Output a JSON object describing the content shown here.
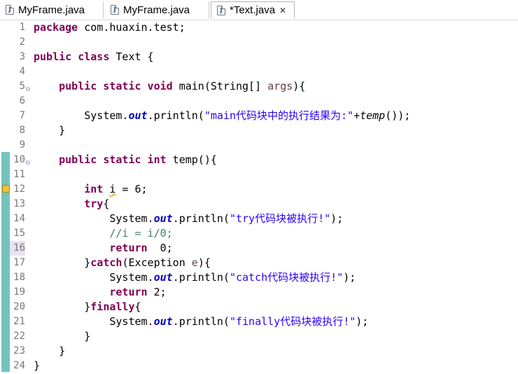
{
  "tabs": [
    {
      "label": "MyFrame.java",
      "active": false
    },
    {
      "label": "MyFrame.java",
      "active": false
    },
    {
      "label": "*Text.java",
      "active": true
    }
  ],
  "icons": {
    "java_file": "java-file-icon",
    "close": "close-icon",
    "warning": "warning-icon",
    "fold": "fold-minus-icon"
  },
  "colors": {
    "keyword": "#7f0055",
    "string": "#2a00ff",
    "field": "#0000c0",
    "comment": "#3f7f5f",
    "change_bar": "#74c3bf"
  },
  "editor": {
    "lines": [
      {
        "n": "1",
        "t": [
          {
            "k": "kw",
            "v": "package"
          },
          {
            "k": "",
            "v": " com.huaxin.test;"
          }
        ]
      },
      {
        "n": "2",
        "t": []
      },
      {
        "n": "3",
        "t": [
          {
            "k": "kw",
            "v": "public class"
          },
          {
            "k": "",
            "v": " Text {"
          }
        ]
      },
      {
        "n": "4",
        "t": []
      },
      {
        "n": "5",
        "fold": true,
        "t": [
          {
            "k": "",
            "v": "    "
          },
          {
            "k": "kw",
            "v": "public static void"
          },
          {
            "k": "",
            "v": " main(String[] "
          },
          {
            "k": "param",
            "v": "args"
          },
          {
            "k": "",
            "v": "){"
          }
        ]
      },
      {
        "n": "6",
        "t": []
      },
      {
        "n": "7",
        "t": [
          {
            "k": "",
            "v": "        System."
          },
          {
            "k": "fld",
            "v": "out"
          },
          {
            "k": "",
            "v": ".println("
          },
          {
            "k": "str",
            "v": "\"main代码块中的执行结果为:\""
          },
          {
            "k": "",
            "v": "+"
          },
          {
            "k": "ital",
            "v": "temp"
          },
          {
            "k": "",
            "v": "());"
          }
        ]
      },
      {
        "n": "8",
        "t": [
          {
            "k": "",
            "v": "    }"
          }
        ]
      },
      {
        "n": "9",
        "t": []
      },
      {
        "n": "10",
        "fold": true,
        "t": [
          {
            "k": "",
            "v": "    "
          },
          {
            "k": "kw",
            "v": "public static int"
          },
          {
            "k": "",
            "v": " temp(){"
          }
        ]
      },
      {
        "n": "11",
        "t": []
      },
      {
        "n": "12",
        "warn": true,
        "t": [
          {
            "k": "",
            "v": "        "
          },
          {
            "k": "kw",
            "v": "int"
          },
          {
            "k": "",
            "v": " "
          },
          {
            "k": "warnu",
            "v": "i"
          },
          {
            "k": "",
            "v": " = 6;"
          }
        ]
      },
      {
        "n": "13",
        "t": [
          {
            "k": "",
            "v": "        "
          },
          {
            "k": "kw",
            "v": "try"
          },
          {
            "k": "",
            "v": "{"
          }
        ]
      },
      {
        "n": "14",
        "t": [
          {
            "k": "",
            "v": "            System."
          },
          {
            "k": "fld",
            "v": "out"
          },
          {
            "k": "",
            "v": ".println("
          },
          {
            "k": "str",
            "v": "\"try代码块被执行!\""
          },
          {
            "k": "",
            "v": ");"
          }
        ]
      },
      {
        "n": "15",
        "t": [
          {
            "k": "",
            "v": "            "
          },
          {
            "k": "cmt",
            "v": "//i = i/0;"
          }
        ]
      },
      {
        "n": "16",
        "cur": true,
        "t": [
          {
            "k": "",
            "v": "            "
          },
          {
            "k": "kw",
            "v": "return"
          },
          {
            "k": "",
            "v": "  0;"
          }
        ]
      },
      {
        "n": "17",
        "t": [
          {
            "k": "",
            "v": "        }"
          },
          {
            "k": "kw",
            "v": "catch"
          },
          {
            "k": "",
            "v": "(Exception "
          },
          {
            "k": "param",
            "v": "e"
          },
          {
            "k": "",
            "v": "){"
          }
        ]
      },
      {
        "n": "18",
        "t": [
          {
            "k": "",
            "v": "            System."
          },
          {
            "k": "fld",
            "v": "out"
          },
          {
            "k": "",
            "v": ".println("
          },
          {
            "k": "str",
            "v": "\"catch代码块被执行!\""
          },
          {
            "k": "",
            "v": ");"
          }
        ]
      },
      {
        "n": "19",
        "t": [
          {
            "k": "",
            "v": "            "
          },
          {
            "k": "kw",
            "v": "return"
          },
          {
            "k": "",
            "v": " 2;"
          }
        ]
      },
      {
        "n": "20",
        "t": [
          {
            "k": "",
            "v": "        }"
          },
          {
            "k": "kw",
            "v": "finally"
          },
          {
            "k": "",
            "v": "{"
          }
        ]
      },
      {
        "n": "21",
        "t": [
          {
            "k": "",
            "v": "            System."
          },
          {
            "k": "fld",
            "v": "out"
          },
          {
            "k": "",
            "v": ".println("
          },
          {
            "k": "str",
            "v": "\"finally代码块被执行!\""
          },
          {
            "k": "",
            "v": ");"
          }
        ]
      },
      {
        "n": "22",
        "t": [
          {
            "k": "",
            "v": "        }"
          }
        ]
      },
      {
        "n": "23",
        "t": [
          {
            "k": "",
            "v": "    }"
          }
        ]
      },
      {
        "n": "24",
        "t": [
          {
            "k": "",
            "v": "}"
          }
        ]
      }
    ]
  }
}
